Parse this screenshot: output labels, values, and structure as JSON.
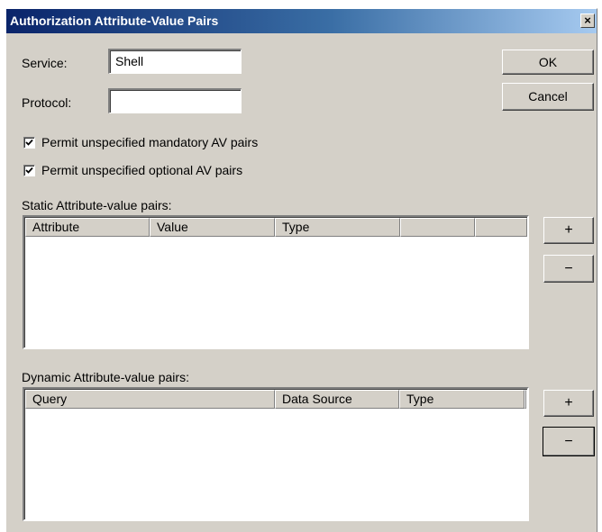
{
  "window": {
    "title": "Authorization Attribute-Value Pairs",
    "close_glyph": "×"
  },
  "service": {
    "label": "Service:",
    "value": "Shell"
  },
  "protocol": {
    "label": "Protocol:",
    "value": ""
  },
  "buttons": {
    "ok": "OK",
    "cancel": "Cancel"
  },
  "checkboxes": {
    "mandatory": {
      "label": "Permit unspecified mandatory AV pairs",
      "checked": true
    },
    "optional": {
      "label": "Permit unspecified optional AV pairs",
      "checked": true
    }
  },
  "static_pairs": {
    "label": "Static Attribute-value pairs:",
    "columns": [
      "Attribute",
      "Value",
      "Type",
      "",
      ""
    ],
    "rows": [],
    "add": "+",
    "remove": "−"
  },
  "dynamic_pairs": {
    "label": "Dynamic Attribute-value pairs:",
    "columns": [
      "Query",
      "Data Source",
      "Type",
      ""
    ],
    "rows": [],
    "add": "+",
    "remove": "−"
  }
}
